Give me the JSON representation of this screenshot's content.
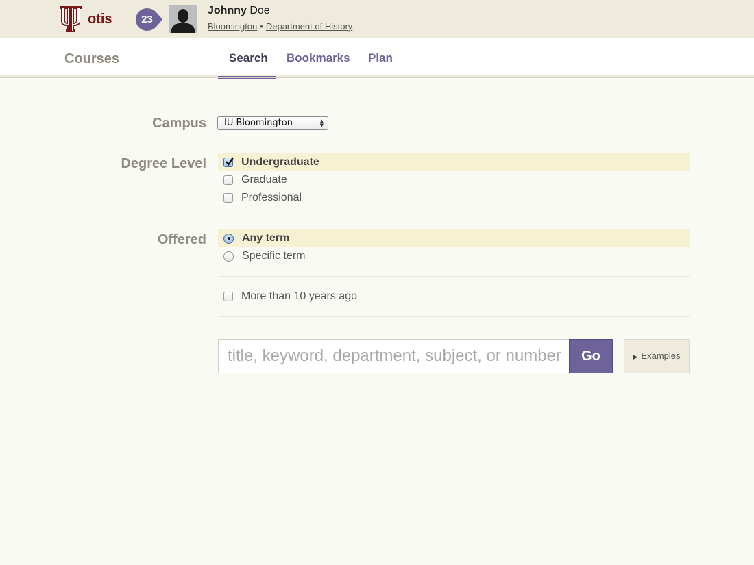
{
  "header": {
    "brand": "otis",
    "notification_count": "23",
    "user": {
      "first_name": "Johnny",
      "last_name": "Doe",
      "campus_link": "Bloomington",
      "separator": "•",
      "department_link": "Department of History"
    }
  },
  "nav": {
    "section_title": "Courses",
    "tabs": [
      {
        "label": "Search",
        "active": true
      },
      {
        "label": "Bookmarks",
        "active": false
      },
      {
        "label": "Plan",
        "active": false
      }
    ]
  },
  "form": {
    "campus": {
      "label": "Campus",
      "selected": "IU Bloomington"
    },
    "degree_level": {
      "label": "Degree Level",
      "options": [
        {
          "label": "Undergraduate",
          "checked": true
        },
        {
          "label": "Graduate",
          "checked": false
        },
        {
          "label": "Professional",
          "checked": false
        }
      ]
    },
    "offered": {
      "label": "Offered",
      "options": [
        {
          "label": "Any term",
          "checked": true
        },
        {
          "label": "Specific term",
          "checked": false
        }
      ]
    },
    "older": {
      "label": "More than 10 years ago",
      "checked": false
    },
    "search": {
      "placeholder": "title, keyword, department, subject, or number",
      "value": "",
      "go_label": "Go",
      "examples_label": "Examples"
    }
  },
  "colors": {
    "brand_crimson": "#7a1717",
    "accent_purple": "#6d629a",
    "header_bg": "#eeeadc",
    "highlight_bg": "#f7f1d3",
    "page_bg": "#fafaf5"
  }
}
